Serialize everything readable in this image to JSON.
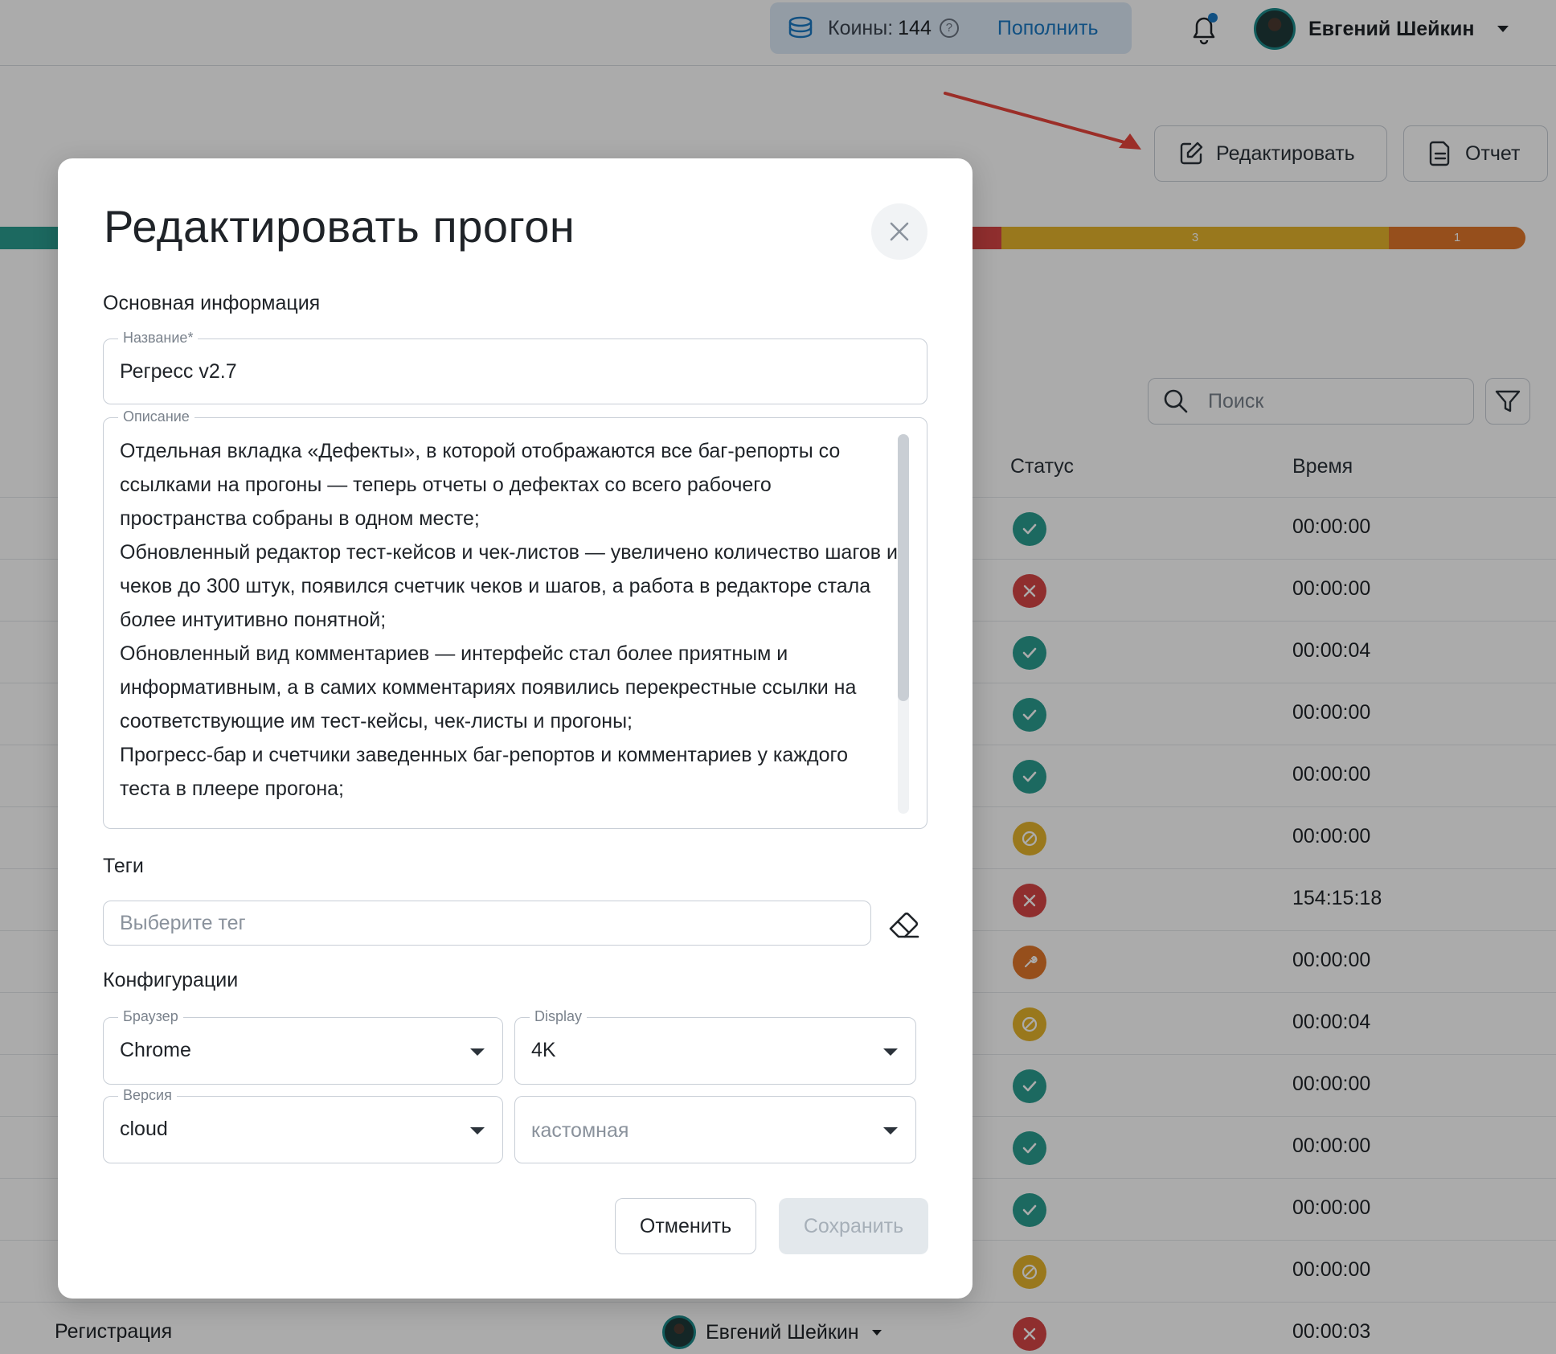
{
  "header": {
    "coins_label": "Коины:",
    "coins_value": "144",
    "help_symbol": "?",
    "topup_label": "Пополнить",
    "user_name": "Евгений Шейкин"
  },
  "toolbar": {
    "edit_label": "Редактировать",
    "report_label": "Отчет"
  },
  "progress_bar": {
    "segments": [
      {
        "label": "",
        "color": "#2a9d8f"
      },
      {
        "label": "",
        "color": "#d64545"
      },
      {
        "label": "3",
        "color": "#e5b42c"
      },
      {
        "label": "1",
        "color": "#e0772a"
      }
    ]
  },
  "table": {
    "search_placeholder": "Поиск",
    "col_status": "Статус",
    "col_time": "Время",
    "rows": [
      {
        "status": "passed",
        "time": "00:00:00",
        "title": ""
      },
      {
        "status": "failed",
        "time": "00:00:00",
        "title": ""
      },
      {
        "status": "passed",
        "time": "00:00:04",
        "title": ""
      },
      {
        "status": "passed",
        "time": "00:00:00",
        "title": ""
      },
      {
        "status": "passed",
        "time": "00:00:00",
        "title": ""
      },
      {
        "status": "skipped",
        "time": "00:00:00",
        "title": ""
      },
      {
        "status": "failed",
        "time": "154:15:18",
        "title": ""
      },
      {
        "status": "blocked",
        "time": "00:00:00",
        "title": ""
      },
      {
        "status": "skipped",
        "time": "00:00:04",
        "title": ""
      },
      {
        "status": "passed",
        "time": "00:00:00",
        "title": ""
      },
      {
        "status": "passed",
        "time": "00:00:00",
        "title": ""
      },
      {
        "status": "passed",
        "time": "00:00:00",
        "title": ""
      },
      {
        "status": "skipped",
        "time": "00:00:00",
        "title": ""
      },
      {
        "status": "failed",
        "time": "00:00:03",
        "title": "Регистрация",
        "assignee": "Евгений Шейкин"
      }
    ]
  },
  "modal": {
    "title": "Редактировать прогон",
    "basic_info_heading": "Основная информация",
    "name_legend": "Название*",
    "name_value": "Регресс v2.7",
    "description_legend": "Описание",
    "description_paragraphs": [
      "Отдельная вкладка «Дефекты», в которой отображаются все баг-репорты со ссылками на прогоны — теперь отчеты о дефектах со всего рабочего пространства собраны в одном месте;",
      "Обновленный редактор тест-кейсов и чек-листов — увеличено количество шагов и чеков до 300 штук, появился счетчик чеков и шагов, а работа в редакторе стала более интуитивно понятной;",
      "Обновленный вид комментариев — интерфейс стал более приятным и информативным, а в самих комментариях появились перекрестные ссылки на соответствующие им тест-кейсы, чек-листы и прогоны;",
      "Прогресс-бар и счетчики заведенных баг-репортов и комментариев у каждого теста в плеере прогона;"
    ],
    "tags_heading": "Теги",
    "tags_placeholder": "Выберите тег",
    "configs_heading": "Конфигурации",
    "browser_legend": "Браузер",
    "browser_value": "Chrome",
    "display_legend": "Display",
    "display_value": "4K",
    "version_legend": "Версия",
    "version_value": "cloud",
    "custom_placeholder": "кастомная",
    "cancel_label": "Отменить",
    "save_label": "Сохранить"
  }
}
